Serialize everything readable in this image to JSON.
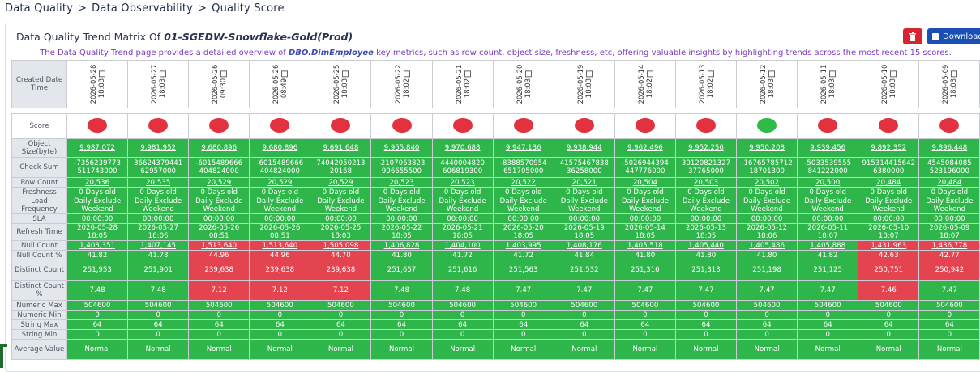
{
  "breadcrumb": [
    "Data Quality",
    "Data Observability",
    "Quality Score"
  ],
  "breadcrumb_sep": ">",
  "panel": {
    "title_prefix": "Data Quality Trend Matrix Of ",
    "title_entity": "01-SGEDW-Snowflake-Gold(Prod)",
    "download_label": "Download",
    "desc_before": "The Data Quality Trend page provides a detailed overview of ",
    "desc_table": "DBO.DimEmployee",
    "desc_after": " key metrics, such as row count, object size, freshness, etc, offering valuable insights by highlighting trends across the most recent 15 scores."
  },
  "row_labels": {
    "created": "Created Date Time",
    "score": "Score",
    "object_size": "Object Size(byte)",
    "checksum": "Check Sum",
    "row_count": "Row Count",
    "freshness": "Freshness",
    "load_frequency": "Load Frequency",
    "sla": "SLA",
    "refresh_time": "Refresh Time",
    "null_count": "Null Count",
    "null_count_pct": "Null Count %",
    "distinct_count": "Distinct Count",
    "distinct_count_pct": "Distinct Count %",
    "numeric_max": "Numeric Max",
    "numeric_min": "Numeric Min",
    "string_max": "String Max",
    "string_min": "String Min",
    "average_value": "Average Value"
  },
  "columns": [
    {
      "date": "2026-05-28",
      "time": "18:03",
      "score": "red",
      "object_size": "9,987,072",
      "checksum1": "-7356239773",
      "checksum2": "511743000",
      "row_count": "20,536",
      "freshness": "0 Days old",
      "load1": "Daily Exclude",
      "load2": "Weekend",
      "sla": "00:00:00",
      "refresh_date": "2026-05-28",
      "refresh_time": "18:05",
      "null_count": "1,408,351",
      "null_red": false,
      "null_pct": "41.82",
      "null_pct_red": false,
      "distinct": "251,953",
      "distinct_red": false,
      "distinct_pct": "7.48",
      "distinct_pct_red": false,
      "num_max": "504600",
      "num_min": "0",
      "str_max": "64",
      "str_min": "0",
      "avg": "Normal"
    },
    {
      "date": "2026-05-27",
      "time": "18:03",
      "score": "red",
      "object_size": "9,981,952",
      "checksum1": "36624379441",
      "checksum2": "62957000",
      "row_count": "20,535",
      "freshness": "0 Days old",
      "load1": "Daily Exclude",
      "load2": "Weekend",
      "sla": "00:00:00",
      "refresh_date": "2026-05-27",
      "refresh_time": "18:06",
      "null_count": "1,407,145",
      "null_red": false,
      "null_pct": "41.78",
      "null_pct_red": false,
      "distinct": "251,901",
      "distinct_red": false,
      "distinct_pct": "7.48",
      "distinct_pct_red": false,
      "num_max": "504600",
      "num_min": "0",
      "str_max": "64",
      "str_min": "0",
      "avg": "Normal"
    },
    {
      "date": "2026-05-26",
      "time": "09:30",
      "score": "red",
      "object_size": "9,680,896",
      "checksum1": "-6015489666",
      "checksum2": "404824000",
      "row_count": "20,529",
      "freshness": "0 Days old",
      "load1": "Daily Exclude",
      "load2": "Weekend",
      "sla": "00:00:00",
      "refresh_date": "2026-05-26",
      "refresh_time": "08:51",
      "null_count": "1,513,640",
      "null_red": true,
      "null_pct": "44.96",
      "null_pct_red": true,
      "distinct": "239,638",
      "distinct_red": true,
      "distinct_pct": "7.12",
      "distinct_pct_red": true,
      "num_max": "504600",
      "num_min": "0",
      "str_max": "64",
      "str_min": "0",
      "avg": "Normal"
    },
    {
      "date": "2026-05-26",
      "time": "08:49",
      "score": "red",
      "object_size": "9,680,896",
      "checksum1": "-6015489666",
      "checksum2": "404824000",
      "row_count": "20,529",
      "freshness": "0 Days old",
      "load1": "Daily Exclude",
      "load2": "Weekend",
      "sla": "00:00:00",
      "refresh_date": "2026-05-26",
      "refresh_time": "08:51",
      "null_count": "1,513,640",
      "null_red": true,
      "null_pct": "44.96",
      "null_pct_red": true,
      "distinct": "239,638",
      "distinct_red": true,
      "distinct_pct": "7.12",
      "distinct_pct_red": true,
      "num_max": "504600",
      "num_min": "0",
      "str_max": "64",
      "str_min": "0",
      "avg": "Normal"
    },
    {
      "date": "2026-05-25",
      "time": "18:03",
      "score": "red",
      "object_size": "9,691,648",
      "checksum1": "74042050213",
      "checksum2": "20168",
      "row_count": "20,529",
      "freshness": "0 Days old",
      "load1": "Daily Exclude",
      "load2": "Weekend",
      "sla": "00:00:00",
      "refresh_date": "2026-05-25",
      "refresh_time": "18:03",
      "null_count": "1,505,098",
      "null_red": true,
      "null_pct": "44.70",
      "null_pct_red": true,
      "distinct": "239,638",
      "distinct_red": true,
      "distinct_pct": "7.12",
      "distinct_pct_red": true,
      "num_max": "504600",
      "num_min": "0",
      "str_max": "64",
      "str_min": "0",
      "avg": "Normal"
    },
    {
      "date": "2026-05-22",
      "time": "18:02",
      "score": "red",
      "object_size": "9,955,840",
      "checksum1": "-2107063823",
      "checksum2": "906655500",
      "row_count": "20,523",
      "freshness": "0 Days old",
      "load1": "Daily Exclude",
      "load2": "Weekend",
      "sla": "00:00:00",
      "refresh_date": "2026-05-22",
      "refresh_time": "18:05",
      "null_count": "1,406,828",
      "null_red": false,
      "null_pct": "41.80",
      "null_pct_red": false,
      "distinct": "251,657",
      "distinct_red": false,
      "distinct_pct": "7.48",
      "distinct_pct_red": false,
      "num_max": "504600",
      "num_min": "0",
      "str_max": "64",
      "str_min": "0",
      "avg": "Normal"
    },
    {
      "date": "2026-05-21",
      "time": "18:02",
      "score": "red",
      "object_size": "9,970,688",
      "checksum1": "4440004820",
      "checksum2": "606819300",
      "row_count": "20,523",
      "freshness": "0 Days old",
      "load1": "Daily Exclude",
      "load2": "Weekend",
      "sla": "00:00:00",
      "refresh_date": "2026-05-21",
      "refresh_time": "18:05",
      "null_count": "1,404,100",
      "null_red": false,
      "null_pct": "41.72",
      "null_pct_red": false,
      "distinct": "251,616",
      "distinct_red": false,
      "distinct_pct": "7.48",
      "distinct_pct_red": false,
      "num_max": "504600",
      "num_min": "0",
      "str_max": "64",
      "str_min": "0",
      "avg": "Normal"
    },
    {
      "date": "2026-05-20",
      "time": "18:03",
      "score": "red",
      "object_size": "9,947,136",
      "checksum1": "-8388570954",
      "checksum2": "651705000",
      "row_count": "20,522",
      "freshness": "0 Days old",
      "load1": "Daily Exclude",
      "load2": "Weekend",
      "sla": "00:00:00",
      "refresh_date": "2026-05-20",
      "refresh_time": "18:05",
      "null_count": "1,403,995",
      "null_red": false,
      "null_pct": "41.72",
      "null_pct_red": false,
      "distinct": "251,563",
      "distinct_red": false,
      "distinct_pct": "7.47",
      "distinct_pct_red": false,
      "num_max": "504600",
      "num_min": "0",
      "str_max": "64",
      "str_min": "0",
      "avg": "Normal"
    },
    {
      "date": "2026-05-19",
      "time": "18:03",
      "score": "red",
      "object_size": "9,938,944",
      "checksum1": "41575467838",
      "checksum2": "36258000",
      "row_count": "20,521",
      "freshness": "0 Days old",
      "load1": "Daily Exclude",
      "load2": "Weekend",
      "sla": "00:00:00",
      "refresh_date": "2026-05-19",
      "refresh_time": "18:05",
      "null_count": "1,408,176",
      "null_red": false,
      "null_pct": "41.84",
      "null_pct_red": false,
      "distinct": "251,532",
      "distinct_red": false,
      "distinct_pct": "7.47",
      "distinct_pct_red": false,
      "num_max": "504600",
      "num_min": "0",
      "str_max": "64",
      "str_min": "0",
      "avg": "Normal"
    },
    {
      "date": "2026-05-14",
      "time": "18:02",
      "score": "red",
      "object_size": "9,962,496",
      "checksum1": "-5026944394",
      "checksum2": "447776000",
      "row_count": "20,504",
      "freshness": "0 Days old",
      "load1": "Daily Exclude",
      "load2": "Weekend",
      "sla": "00:00:00",
      "refresh_date": "2026-05-14",
      "refresh_time": "18:05",
      "null_count": "1,405,518",
      "null_red": false,
      "null_pct": "41.80",
      "null_pct_red": false,
      "distinct": "251,316",
      "distinct_red": false,
      "distinct_pct": "7.47",
      "distinct_pct_red": false,
      "num_max": "504600",
      "num_min": "0",
      "str_max": "64",
      "str_min": "0",
      "avg": "Normal"
    },
    {
      "date": "2026-05-13",
      "time": "18:02",
      "score": "red",
      "object_size": "9,952,256",
      "checksum1": "30120821327",
      "checksum2": "37765000",
      "row_count": "20,503",
      "freshness": "0 Days old",
      "load1": "Daily Exclude",
      "load2": "Weekend",
      "sla": "00:00:00",
      "refresh_date": "2026-05-13",
      "refresh_time": "18:05",
      "null_count": "1,405,440",
      "null_red": false,
      "null_pct": "41.80",
      "null_pct_red": false,
      "distinct": "251,313",
      "distinct_red": false,
      "distinct_pct": "7.47",
      "distinct_pct_red": false,
      "num_max": "504600",
      "num_min": "0",
      "str_max": "64",
      "str_min": "0",
      "avg": "Normal"
    },
    {
      "date": "2026-05-12",
      "time": "18:03",
      "score": "green",
      "object_size": "9,950,208",
      "checksum1": "-16765785712",
      "checksum2": "18701300",
      "row_count": "20,502",
      "freshness": "0 Days old",
      "load1": "Daily Exclude",
      "load2": "Weekend",
      "sla": "00:00:00",
      "refresh_date": "2026-05-12",
      "refresh_time": "18:06",
      "null_count": "1,405,486",
      "null_red": false,
      "null_pct": "41.80",
      "null_pct_red": false,
      "distinct": "251,198",
      "distinct_red": false,
      "distinct_pct": "7.47",
      "distinct_pct_red": false,
      "num_max": "504600",
      "num_min": "0",
      "str_max": "64",
      "str_min": "0",
      "avg": "Normal"
    },
    {
      "date": "2026-05-11",
      "time": "18:03",
      "score": "red",
      "object_size": "9,939,456",
      "checksum1": "-5033539555",
      "checksum2": "841222000",
      "row_count": "20,500",
      "freshness": "0 Days old",
      "load1": "Daily Exclude",
      "load2": "Weekend",
      "sla": "00:00:00",
      "refresh_date": "2026-05-11",
      "refresh_time": "18:07",
      "null_count": "1,405,888",
      "null_red": false,
      "null_pct": "41.82",
      "null_pct_red": false,
      "distinct": "251,125",
      "distinct_red": false,
      "distinct_pct": "7.47",
      "distinct_pct_red": false,
      "num_max": "504600",
      "num_min": "0",
      "str_max": "64",
      "str_min": "0",
      "avg": "Normal"
    },
    {
      "date": "2026-05-10",
      "time": "18:03",
      "score": "red",
      "object_size": "9,892,352",
      "checksum1": "915314415642",
      "checksum2": "6380000",
      "row_count": "20,484",
      "freshness": "0 Days old",
      "load1": "Daily Exclude",
      "load2": "Weekend",
      "sla": "00:00:00",
      "refresh_date": "2026-05-10",
      "refresh_time": "18:07",
      "null_count": "1,431,963",
      "null_red": true,
      "null_pct": "42.63",
      "null_pct_red": true,
      "distinct": "250,751",
      "distinct_red": true,
      "distinct_pct": "7.46",
      "distinct_pct_red": true,
      "num_max": "504600",
      "num_min": "0",
      "str_max": "64",
      "str_min": "0",
      "avg": "Normal"
    },
    {
      "date": "2026-05-09",
      "time": "18:03",
      "score": "red",
      "object_size": "9,896,448",
      "checksum1": "4545084085",
      "checksum2": "523196000",
      "row_count": "20,484",
      "freshness": "0 Days old",
      "load1": "Daily Exclude",
      "load2": "Weekend",
      "sla": "00:00:00",
      "refresh_date": "2026-05-09",
      "refresh_time": "18:07",
      "null_count": "1,436,778",
      "null_red": true,
      "null_pct": "42.77",
      "null_pct_red": true,
      "distinct": "250,942",
      "distinct_red": true,
      "distinct_pct": "7.47",
      "distinct_pct_red": false,
      "num_max": "504600",
      "num_min": "0",
      "str_max": "64",
      "str_min": "0",
      "avg": "Normal"
    }
  ]
}
